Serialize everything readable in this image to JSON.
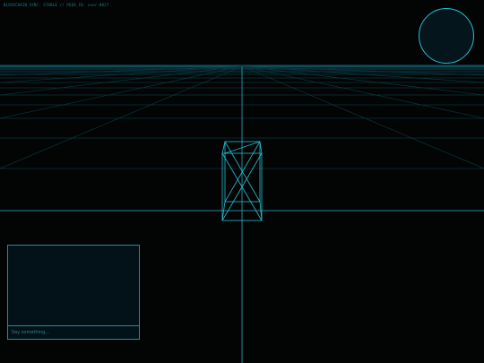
{
  "hud": {
    "status_text": "BLOCKCHAIN SYNC: STABLE // PEER_ID: user-8827"
  },
  "chat": {
    "log_text": "",
    "input_placeholder": "Say something..."
  },
  "colors": {
    "background": "#030404",
    "accent": "#27bfd2",
    "grid": "#0d4f5a",
    "panel_bg": "#031218"
  },
  "scene": {
    "objects": [
      {
        "type": "wireframe-cuboid",
        "label": ""
      }
    ]
  }
}
